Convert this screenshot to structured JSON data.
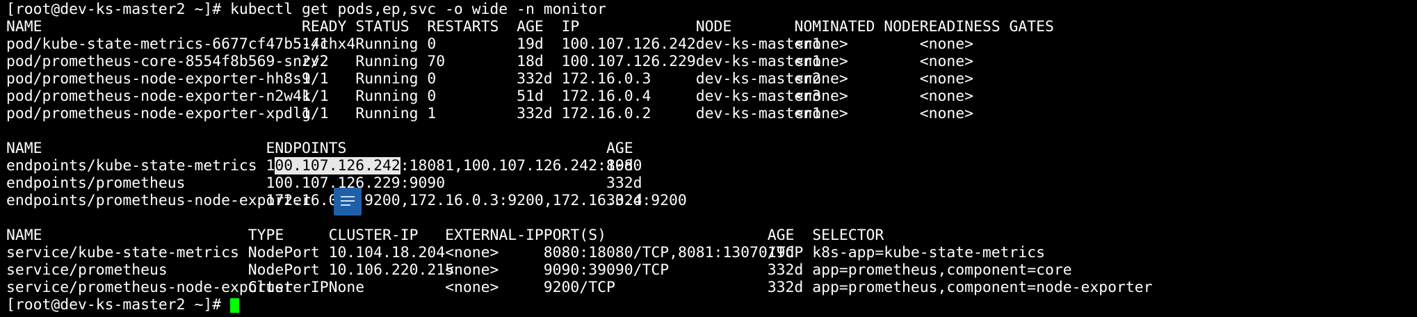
{
  "colors": {
    "background": "#000000",
    "text": "#ffffff",
    "cursor": "#00ff00",
    "selection_bg": "#e8e8e8",
    "selection_fg": "#000000",
    "widget": "#1f5fa8"
  },
  "prompt": {
    "first": "[root@dev-ks-master2 ~]# kubectl get pods,ep,svc -o wide -n monitor",
    "last": "[root@dev-ks-master2 ~]# "
  },
  "pods": {
    "headers": [
      "NAME",
      "READY",
      "STATUS",
      "RESTARTS",
      "AGE",
      "IP",
      "NODE",
      "NOMINATED NODE",
      "READINESS GATES"
    ],
    "rows": [
      [
        "pod/kube-state-metrics-6677cf47b5-4chx4",
        "1/1",
        "Running",
        "0",
        "19d",
        "100.107.126.242",
        "dev-ks-master1",
        "<none>",
        "<none>"
      ],
      [
        "pod/prometheus-core-8554f8b569-snrv2",
        "2/2",
        "Running",
        "70",
        "18d",
        "100.107.126.229",
        "dev-ks-master1",
        "<none>",
        "<none>"
      ],
      [
        "pod/prometheus-node-exporter-hh8s9",
        "1/1",
        "Running",
        "0",
        "332d",
        "172.16.0.3",
        "dev-ks-master2",
        "<none>",
        "<none>"
      ],
      [
        "pod/prometheus-node-exporter-n2w4k",
        "1/1",
        "Running",
        "0",
        "51d",
        "172.16.0.4",
        "dev-ks-master3",
        "<none>",
        "<none>"
      ],
      [
        "pod/prometheus-node-exporter-xpdlg",
        "1/1",
        "Running",
        "1",
        "332d",
        "172.16.0.2",
        "dev-ks-master1",
        "<none>",
        "<none>"
      ]
    ]
  },
  "endpoints": {
    "headers": [
      "NAME",
      "ENDPOINTS",
      "AGE"
    ],
    "rows": [
      [
        "endpoints/kube-state-metrics",
        "100.107.126.242:18081,100.107.126.242:8080",
        "19d"
      ],
      [
        "endpoints/prometheus",
        "100.107.126.229:9090",
        "332d"
      ],
      [
        "endpoints/prometheus-node-exporter",
        "172.16.0.2:9200,172.16.0.3:9200,172.16.0.4:9200",
        "332d"
      ]
    ]
  },
  "services": {
    "headers": [
      "NAME",
      "TYPE",
      "CLUSTER-IP",
      "EXTERNAL-IP",
      "PORT(S)",
      "AGE",
      "SELECTOR"
    ],
    "rows": [
      [
        "service/kube-state-metrics",
        "NodePort",
        "10.104.18.204",
        "<none>",
        "8080:18080/TCP,8081:13070/TCP",
        "19d",
        "k8s-app=kube-state-metrics"
      ],
      [
        "service/prometheus",
        "NodePort",
        "10.106.220.215",
        "<none>",
        "9090:39090/TCP",
        "332d",
        "app=prometheus,component=core"
      ],
      [
        "service/prometheus-node-exporter",
        "ClusterIP",
        "None",
        "<none>",
        "9200/TCP",
        "332d",
        "app=prometheus,component=node-exporter"
      ]
    ]
  },
  "selection": {
    "prefix": "1",
    "selected": "00.107.126.242",
    "suffix": ":18081,100.107.126.242:8080"
  },
  "widget_icon": "document-icon"
}
